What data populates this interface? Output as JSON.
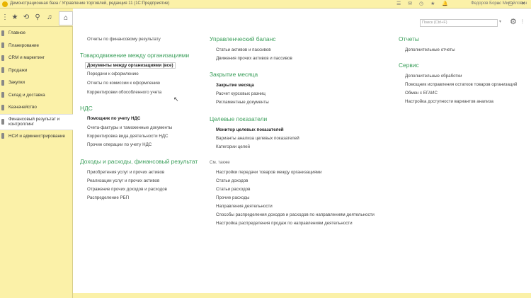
{
  "window": {
    "title": "Демонстрационная база / Управление торговлей, редакция 11  (1С:Предприятие)",
    "user": "Федоров Борис Михайлович"
  },
  "search": {
    "placeholder": "Поиск (Ctrl+F)"
  },
  "sidebar": {
    "items": [
      {
        "label": "Главное"
      },
      {
        "label": "Планирование"
      },
      {
        "label": "CRM и маркетинг"
      },
      {
        "label": "Продажи"
      },
      {
        "label": "Закупки"
      },
      {
        "label": "Склад и доставка"
      },
      {
        "label": "Казначейство"
      },
      {
        "label": "Финансовый результат и контроллинг"
      },
      {
        "label": "НСИ и администрирование"
      }
    ]
  },
  "col1": {
    "top_link": "Отчеты по финансовому результату",
    "sec1": {
      "title": "Товародвижение между организациями",
      "links": [
        "Документы между организациями (все)",
        "Передачи к оформлению",
        "Отчеты по комиссии к оформлению",
        "Корректировки обособленного учета"
      ]
    },
    "sec2": {
      "title": "НДС",
      "links": [
        "Помощник по учету НДС",
        "Счета-фактуры и таможенные документы",
        "Корректировка вида деятельности НДС",
        "Прочие операции по учету НДС"
      ]
    },
    "sec3": {
      "title": "Доходы и расходы, финансовый результат",
      "links": [
        "Приобретения услуг и прочих активов",
        "Реализации услуг и прочих активов",
        "Отражение прочих доходов и расходов",
        "Распределение РБП"
      ]
    }
  },
  "col2": {
    "sec1": {
      "title": "Управленческий баланс",
      "links": [
        "Статьи активов и пассивов",
        "Движения прочих активов и пассивов"
      ]
    },
    "sec2": {
      "title": "Закрытие месяца",
      "links": [
        "Закрытие месяца",
        "Расчет курсовых разниц",
        "Регламентные документы"
      ]
    },
    "sec3": {
      "title": "Целевые показатели",
      "links": [
        "Монитор целевых показателей",
        "Варианты анализа целевых показателей",
        "Категории целей"
      ]
    },
    "see_also": {
      "title": "См. также",
      "links": [
        "Настройки передачи товаров между организациями",
        "Статьи доходов",
        "Статьи расходов",
        "Прочие расходы",
        "Направления деятельности",
        "Способы распределения доходов и расходов по направлениям деятельности",
        "Настройка распределения продаж по направлениям деятельности"
      ]
    }
  },
  "col3": {
    "sec1": {
      "title": "Отчеты",
      "links": [
        "Дополнительные отчеты"
      ]
    },
    "sec2": {
      "title": "Сервис",
      "links": [
        "Дополнительные обработки",
        "Помощник исправления остатков товаров организаций",
        "Обмен с ЕГАИС",
        "Настройка доступности вариантов анализа"
      ]
    }
  }
}
